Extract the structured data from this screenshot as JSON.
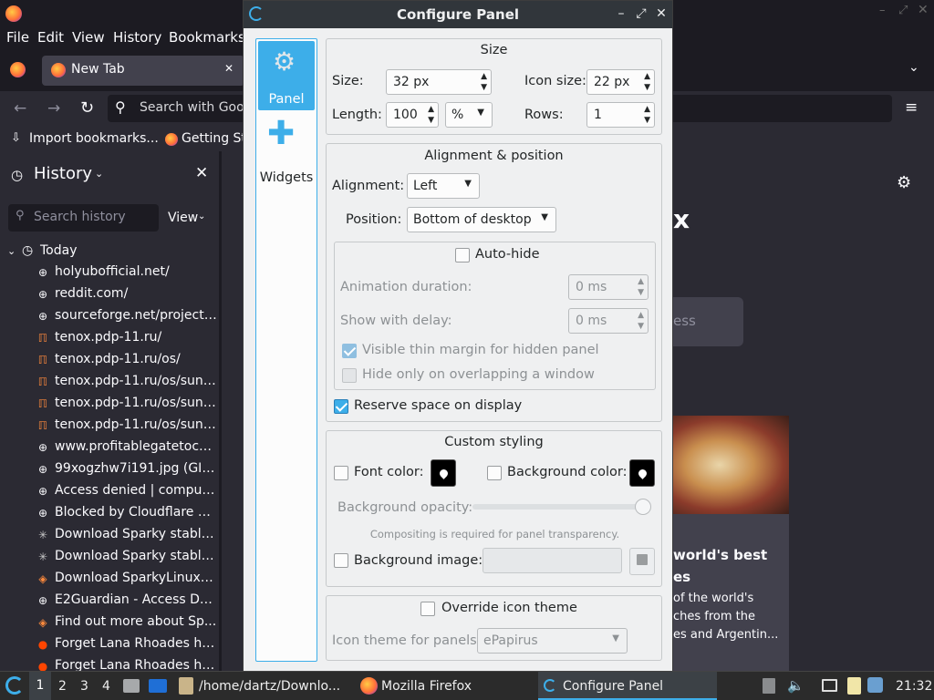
{
  "firefox": {
    "menu": [
      "File",
      "Edit",
      "View",
      "History",
      "Bookmarks"
    ],
    "tab_label": "New Tab",
    "url_placeholder": "Search with Goo",
    "bookmarks": [
      "Import bookmarks...",
      "Getting St"
    ],
    "sidebar": {
      "title": "History",
      "search_placeholder": "Search history",
      "view_label": "View",
      "group_label": "Today",
      "items": [
        "holyubofficial.net/",
        "reddit.com/",
        "sourceforge.net/projects...",
        "tenox.pdp-11.ru/",
        "tenox.pdp-11.ru/os/",
        "tenox.pdp-11.ru/os/suno...",
        "tenox.pdp-11.ru/os/suno...",
        "tenox.pdp-11.ru/os/suno...",
        "www.profitablegatetoco...",
        "99xogzhw7i191.jpg (GIF...",
        "Access denied | comput...",
        "Blocked by Cloudflare G...",
        "Download Sparky stable...",
        "Download Sparky stable...",
        "Download SparkyLinux f...",
        "E2Guardian - Access De...",
        "Find out more about Sp...",
        "Forget Lana Rhoades he...",
        "Forget Lana Rhoades he..."
      ]
    },
    "content": {
      "search_partial": "ess",
      "story_title_1": "world's best",
      "story_title_2": "es",
      "story_text_1": "of the world's",
      "story_text_2": "ches from the",
      "story_text_3": "es and Argentin...",
      "logo_partial": "x"
    }
  },
  "dialog": {
    "title": "Configure Panel",
    "pages": [
      {
        "label": "Panel"
      },
      {
        "label": "Widgets"
      }
    ],
    "size_group": {
      "title": "Size",
      "size_label": "Size:",
      "size_value": "32 px",
      "icon_size_label": "Icon size:",
      "icon_size_value": "22 px",
      "length_label": "Length:",
      "length_value": "100",
      "length_unit": "%",
      "rows_label": "Rows:",
      "rows_value": "1"
    },
    "alignment_group": {
      "title": "Alignment & position",
      "alignment_label": "Alignment:",
      "alignment_value": "Left",
      "position_label": "Position:",
      "position_value": "Bottom of desktop",
      "autohide_label": "Auto-hide",
      "autohide_checked": false,
      "anim_label": "Animation duration:",
      "anim_value": "0 ms",
      "delay_label": "Show with delay:",
      "delay_value": "0 ms",
      "thin_margin_label": "Visible thin margin for hidden panel",
      "thin_margin_checked": true,
      "overlap_label": "Hide only on overlapping a window",
      "overlap_checked": false,
      "reserve_label": "Reserve space on display",
      "reserve_checked": true
    },
    "styling_group": {
      "title": "Custom styling",
      "font_color_label": "Font color:",
      "font_color_checked": false,
      "font_color": "#000000",
      "bg_color_label": "Background color:",
      "bg_color_checked": false,
      "bg_color": "#000000",
      "opacity_label": "Background opacity:",
      "opacity_value": 1.0,
      "compositing_note": "Compositing is required for panel transparency.",
      "bg_image_label": "Background image:",
      "bg_image_checked": false
    },
    "icon_group": {
      "override_label": "Override icon theme",
      "override_checked": false,
      "theme_label": "Icon theme for panels:",
      "theme_value": "ePapirus"
    }
  },
  "taskbar": {
    "desktops": [
      "1",
      "2",
      "3",
      "4"
    ],
    "tasks": [
      "/home/dartz/Downlo...",
      "Mozilla Firefox",
      "Configure Panel"
    ],
    "clock": "21:32"
  },
  "colors": {
    "accent": "#3daee9",
    "firefox_bg": "#1c1b22",
    "dialog_bg": "#eff0f1"
  }
}
